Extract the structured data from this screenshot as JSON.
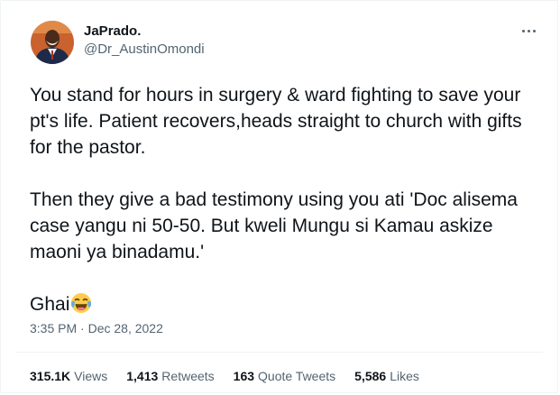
{
  "tweet": {
    "author": {
      "display_name": "JaPrado.",
      "handle": "@Dr_AustinOmondi",
      "avatar_icon": "profile-photo"
    },
    "paragraphs": [
      "You stand for hours in surgery & ward fighting to save your pt's life. Patient recovers,heads straight to church with gifts for the pastor.",
      "Then they give a bad testimony using you ati 'Doc alisema case yangu ni 50-50. But kweli Mungu si Kamau askize maoni ya binadamu.'",
      "Ghai"
    ],
    "emoji": "face-with-tears-of-joy",
    "timestamp": "3:35 PM · Dec 28, 2022",
    "stats": {
      "views": {
        "count": "315.1K",
        "label": "Views"
      },
      "retweets": {
        "count": "1,413",
        "label": "Retweets"
      },
      "quotes": {
        "count": "163",
        "label": "Quote Tweets"
      },
      "likes": {
        "count": "5,586",
        "label": "Likes"
      }
    }
  },
  "colors": {
    "text": "#0f1419",
    "secondary_text": "#536471",
    "divider": "#eff3f4"
  }
}
